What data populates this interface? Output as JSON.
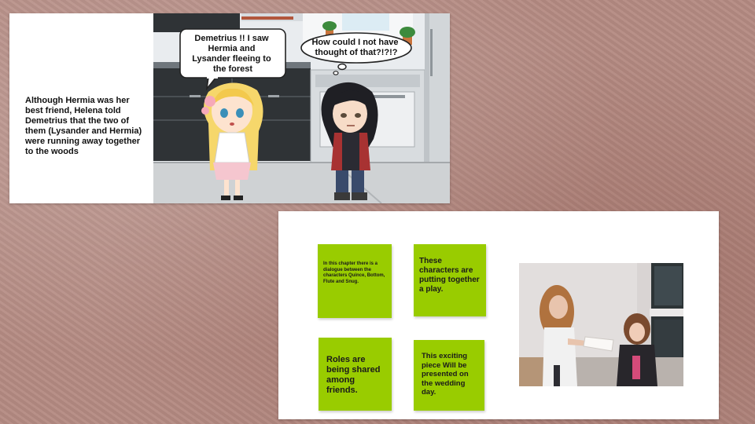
{
  "slide_top": {
    "caption": "Although Hermia was her best friend, Helena told Demetrius that the two of them (Lysander and Hermia) were running away together to the woods",
    "speech_bubble": [
      "Demetrius !! I saw",
      "Hermia and",
      "Lysander fleeing to",
      "the forest"
    ],
    "thought_bubble": [
      "How could I not have",
      "thought of that?!?!?"
    ]
  },
  "slide_bottom": {
    "notes": [
      "In this chapter there is a dialogue between the characters Quince, Bottom, Flute and Snug.",
      "These characters are putting together a play.",
      "Roles are being shared among friends.",
      "This exciting piece Will be presented on the wedding day."
    ]
  },
  "colors": {
    "background": "#b48a82",
    "sticky_note": "#99cc00"
  }
}
